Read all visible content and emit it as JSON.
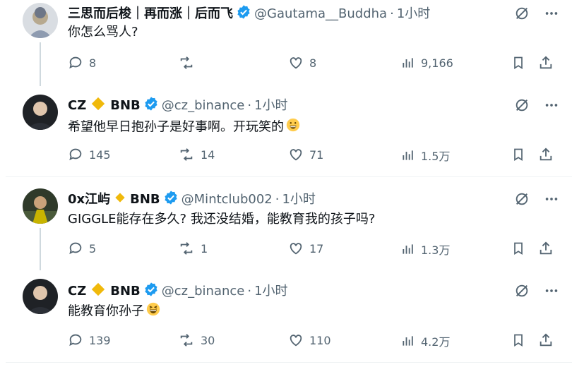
{
  "colors": {
    "verified_blue": "#1d9bf0",
    "bnb_orange": "#f0b90b",
    "muted": "#536471",
    "text": "#0f1419"
  },
  "tweets": [
    {
      "name": "三思而后梭｜再而涨｜后而飞",
      "handle": "@Gautama__Buddha",
      "dot": "·",
      "time": "1小时",
      "text": "你怎么骂人?",
      "replies": "8",
      "retweets": "",
      "likes": "8",
      "views": "9,166"
    },
    {
      "name": "CZ",
      "badge_label": "BNB",
      "handle": "@cz_binance",
      "dot": "·",
      "time": "1小时",
      "text": "希望他早日抱孙子是好事啊。开玩笑的",
      "replies": "145",
      "retweets": "14",
      "likes": "71",
      "views": "1.5万"
    },
    {
      "name": "0x江屿",
      "badge_label": "BNB",
      "handle": "@Mintclub002",
      "dot": "·",
      "time": "1小时",
      "text": "GIGGLE能存在多久? 我还没结婚，能教育我的孩子吗?",
      "replies": "5",
      "retweets": "1",
      "likes": "17",
      "views": "1.3万"
    },
    {
      "name": "CZ",
      "badge_label": "BNB",
      "handle": "@cz_binance",
      "dot": "·",
      "time": "1小时",
      "text": "能教育你孙子",
      "replies": "139",
      "retweets": "30",
      "likes": "110",
      "views": "4.2万"
    }
  ]
}
